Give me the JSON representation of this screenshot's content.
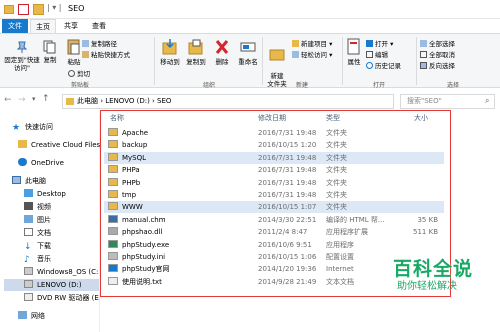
{
  "window": {
    "title": "SEO",
    "quick_access_marks": "| ▾ |"
  },
  "tabs": [
    {
      "label": "文件",
      "kind": "file"
    },
    {
      "label": "主页",
      "kind": "active"
    },
    {
      "label": "共享",
      "kind": "normal"
    },
    {
      "label": "查看",
      "kind": "normal"
    }
  ],
  "ribbon": {
    "pin_quick_access": "固定到\"快速访问\"",
    "copy": "复制",
    "paste": "粘贴",
    "copy_path": "复制路径",
    "paste_shortcut": "粘贴快捷方式",
    "cut": "剪切",
    "group_clipboard": "剪贴板",
    "move_to": "移动到",
    "copy_to": "复制到",
    "delete": "删除",
    "rename": "重命名",
    "group_organize": "组织",
    "new_folder": "新建\n文件夹",
    "new_item": "新建项目 ▾",
    "easy_access": "轻松访问 ▾",
    "group_new": "新建",
    "properties": "属性",
    "open": "打开 ▾",
    "edit": "编辑",
    "history": "历史记录",
    "group_open": "打开",
    "select_all": "全部选择",
    "select_none": "全部取消",
    "invert_selection": "反向选择",
    "group_select": "选择"
  },
  "address": {
    "path": "此电脑  ›  LENOVO (D:)  ›  SEO",
    "search_placeholder": "搜索\"SEO\""
  },
  "nav": [
    {
      "label": "快速访问",
      "icon": "star-icon"
    },
    {
      "label": "Creative Cloud Files",
      "icon": "folder-icon"
    },
    {
      "label": "OneDrive",
      "icon": "cloud-icon"
    },
    {
      "label": "此电脑",
      "icon": "computer-icon"
    },
    {
      "label": "Desktop",
      "icon": "folder-icon"
    },
    {
      "label": "视频",
      "icon": "video-icon"
    },
    {
      "label": "图片",
      "icon": "picture-icon"
    },
    {
      "label": "文档",
      "icon": "document-icon"
    },
    {
      "label": "下载",
      "icon": "download-icon"
    },
    {
      "label": "音乐",
      "icon": "music-icon"
    },
    {
      "label": "Windows8_OS (C:",
      "icon": "drive-icon"
    },
    {
      "label": "LENOVO (D:)",
      "icon": "drive-icon"
    },
    {
      "label": "DVD RW 驱动器 (E",
      "icon": "dvd-icon"
    },
    {
      "label": "网络",
      "icon": "network-icon"
    }
  ],
  "columns": {
    "name": "名称",
    "date": "修改日期",
    "type": "类型",
    "size": "大小"
  },
  "files": [
    {
      "name": "Apache",
      "date": "2016/7/31 19:48",
      "type": "文件夹",
      "size": "",
      "icon": "folder-icon"
    },
    {
      "name": "backup",
      "date": "2016/10/15 1:20",
      "type": "文件夹",
      "size": "",
      "icon": "folder-icon"
    },
    {
      "name": "MySQL",
      "date": "2016/7/31 19:48",
      "type": "文件夹",
      "size": "",
      "icon": "folder-icon"
    },
    {
      "name": "PHPa",
      "date": "2016/7/31 19:48",
      "type": "文件夹",
      "size": "",
      "icon": "folder-icon"
    },
    {
      "name": "PHPb",
      "date": "2016/7/31 19:48",
      "type": "文件夹",
      "size": "",
      "icon": "folder-icon"
    },
    {
      "name": "tmp",
      "date": "2016/7/31 19:48",
      "type": "文件夹",
      "size": "",
      "icon": "folder-icon"
    },
    {
      "name": "WWW",
      "date": "2016/10/15 1:07",
      "type": "文件夹",
      "size": "",
      "icon": "folder-icon"
    },
    {
      "name": "manual.chm",
      "date": "2014/3/30 22:51",
      "type": "编译的 HTML 帮...",
      "size": "35 KB",
      "icon": "help-file-icon"
    },
    {
      "name": "phpshao.dll",
      "date": "2011/2/4 8:47",
      "type": "应用程序扩展",
      "size": "511 KB",
      "icon": "dll-file-icon"
    },
    {
      "name": "phpStudy.exe",
      "date": "2016/10/6 9:51",
      "type": "应用程序",
      "size": "",
      "icon": "exe-icon"
    },
    {
      "name": "phpStudy.ini",
      "date": "2016/10/15 1:06",
      "type": "配置设置",
      "size": "",
      "icon": "ini-file-icon"
    },
    {
      "name": "phpStudy官网",
      "date": "2014/1/20 19:36",
      "type": "Internet",
      "size": "",
      "icon": "url-file-icon"
    },
    {
      "name": "使用说明.txt",
      "date": "2014/9/28 21:49",
      "type": "文本文档",
      "size": "",
      "icon": "text-file-icon"
    }
  ],
  "watermark": {
    "brand": "百科全说",
    "slogan": "助你轻松解决"
  },
  "colors": {
    "accent": "#1979ca",
    "folder": "#e8b84a",
    "highlight": "#ccdaec",
    "annotation": "#e53935"
  }
}
